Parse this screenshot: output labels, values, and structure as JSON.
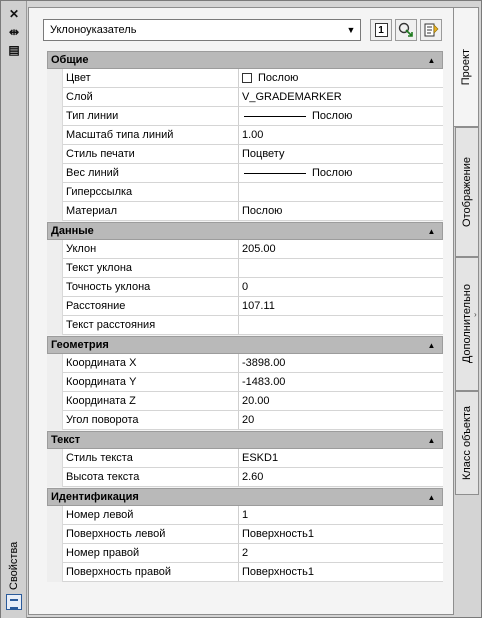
{
  "window": {
    "side_title": "Свойства"
  },
  "toolbar": {
    "object_type": "Уклоноуказатель",
    "num_button": "1"
  },
  "tabs": [
    {
      "label": "Проект",
      "active": true
    },
    {
      "label": "Отображение",
      "active": false
    },
    {
      "label": "Дополнительно",
      "active": false
    },
    {
      "label": "Класс объекта",
      "active": false
    }
  ],
  "sections": {
    "general": {
      "title": "Общие",
      "rows": [
        {
          "name": "Цвет",
          "value": "Послою"
        },
        {
          "name": "Слой",
          "value": "V_GRADEMARKER"
        },
        {
          "name": "Тип линии",
          "value": "Послою"
        },
        {
          "name": "Масштаб типа линий",
          "value": "1.00"
        },
        {
          "name": "Стиль печати",
          "value": "Поцвету"
        },
        {
          "name": "Вес линий",
          "value": "Послою"
        },
        {
          "name": "Гиперссылка",
          "value": ""
        },
        {
          "name": "Материал",
          "value": "Послою"
        }
      ]
    },
    "data": {
      "title": "Данные",
      "rows": [
        {
          "name": "Уклон",
          "value": "205.00"
        },
        {
          "name": "Текст уклона",
          "value": ""
        },
        {
          "name": "Точность уклона",
          "value": "0"
        },
        {
          "name": "Расстояние",
          "value": "107.11"
        },
        {
          "name": "Текст расстояния",
          "value": ""
        }
      ]
    },
    "geometry": {
      "title": "Геометрия",
      "rows": [
        {
          "name": "Координата X",
          "value": "-3898.00"
        },
        {
          "name": "Координата Y",
          "value": "-1483.00"
        },
        {
          "name": "Координата Z",
          "value": "20.00"
        },
        {
          "name": "Угол поворота",
          "value": "20"
        }
      ]
    },
    "text": {
      "title": "Текст",
      "rows": [
        {
          "name": "Стиль текста",
          "value": "ESKD1"
        },
        {
          "name": "Высота текста",
          "value": "2.60"
        }
      ]
    },
    "identification": {
      "title": "Идентификация",
      "rows": [
        {
          "name": "Номер левой",
          "value": "1"
        },
        {
          "name": "Поверхность левой",
          "value": "Поверхность1"
        },
        {
          "name": "Номер правой",
          "value": "2"
        },
        {
          "name": "Поверхность правой",
          "value": "Поверхность1"
        }
      ]
    }
  }
}
